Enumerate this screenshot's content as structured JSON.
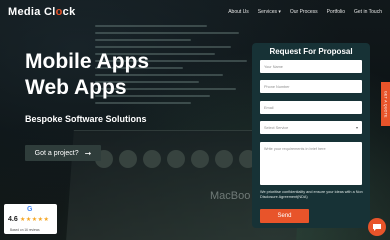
{
  "brand": {
    "logo_main": "Media Cl",
    "logo_accent": "o",
    "logo_end": "ck"
  },
  "nav": {
    "items": [
      {
        "label": "About Us"
      },
      {
        "label": "Services ▾"
      },
      {
        "label": "Our Process"
      },
      {
        "label": "Portfolio"
      },
      {
        "label": "Get in Touch"
      }
    ]
  },
  "hero": {
    "title_line1": "Mobile Apps",
    "title_line2": "Web Apps",
    "subtitle": "Bespoke Software Solutions",
    "cta_label": "Got a project?",
    "cta_arrow": "➞",
    "background_brand": "MacBoo"
  },
  "form": {
    "title": "Request For Proposal",
    "name_placeholder": "Your Name",
    "phone_placeholder": "Phone Number",
    "email_placeholder": "Email",
    "service_placeholder": "Select Service",
    "message_placeholder": "Write your requirements in brief here",
    "privacy_text": "We prioritise confidentiality and ensure your ideas with a Non Disclosure Agreement(NDA)",
    "send_label": "Send"
  },
  "side_tab": {
    "label": "GET A QUOTE"
  },
  "rating": {
    "score": "4.6",
    "stars": "★★★★★",
    "reviews_text": "Based on 16 reviews",
    "google_icon": "G"
  },
  "colors": {
    "accent": "#e8542a",
    "panel": "#173236",
    "cta": "#2f3d3b"
  },
  "icons": {
    "cta": "arrow-right-icon",
    "chat": "chat-bubble-icon",
    "google": "google-icon"
  }
}
